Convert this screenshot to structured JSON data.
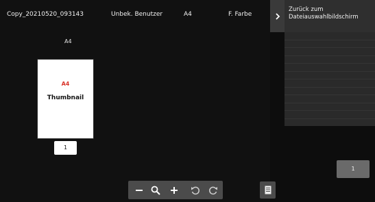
{
  "header": {
    "file_name": "Copy_20210520_093143",
    "user": "Unbek. Benutzer",
    "paper_size": "A4",
    "color_mode": "F. Farbe"
  },
  "back_panel": {
    "label": "Zurück zum Dateiauswahlbildschirm",
    "icon": "chevron-right-icon"
  },
  "preview": {
    "page_size_label": "A4",
    "thumbnail_size_text": "A4",
    "thumbnail_text": "Thumbnail",
    "page_number": "1"
  },
  "page_indicator": "1",
  "toolbar": {
    "icons": [
      "minus-icon",
      "zoom-icon",
      "plus-icon",
      "rotate-left-icon",
      "rotate-right-icon"
    ],
    "list_icon": "document-list-icon"
  },
  "colors": {
    "background": "#111111",
    "panel": "#2a2a2a",
    "toolbar": "#4b4b4b",
    "thumbnail_accent": "#d9352b"
  }
}
